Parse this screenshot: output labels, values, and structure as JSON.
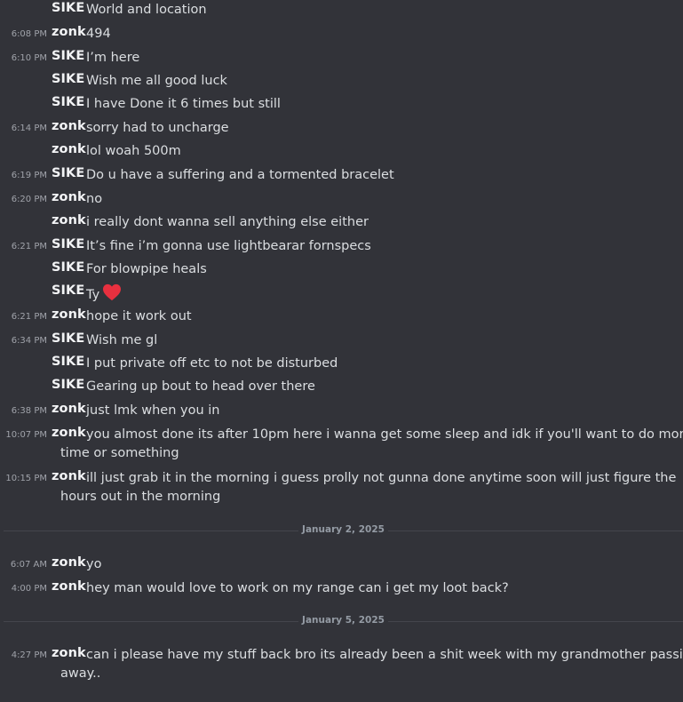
{
  "messages": [
    {
      "time": "",
      "author": "SIKE",
      "text": "World and location"
    },
    {
      "time": "6:08 PM",
      "author": "zonk",
      "text": "494"
    },
    {
      "time": "6:10 PM",
      "author": "SIKE",
      "text": "I’m here"
    },
    {
      "time": "",
      "author": "SIKE",
      "text": "Wish me all good luck"
    },
    {
      "time": "",
      "author": "SIKE",
      "text": "I have Done it 6 times but still"
    },
    {
      "time": "6:14 PM",
      "author": "zonk",
      "text": "sorry had to uncharge"
    },
    {
      "time": "",
      "author": "zonk",
      "text": "lol woah 500m"
    },
    {
      "time": "6:19 PM",
      "author": "SIKE",
      "text": "Do u have a suffering and a tormented bracelet"
    },
    {
      "time": "6:20 PM",
      "author": "zonk",
      "text": "no"
    },
    {
      "time": "",
      "author": "zonk",
      "text": "i really dont wanna sell anything else either"
    },
    {
      "time": "6:21 PM",
      "author": "SIKE",
      "text": "It’s fine i’m gonna use lightbearar fornspecs"
    },
    {
      "time": "",
      "author": "SIKE",
      "text": "For blowpipe heals"
    },
    {
      "time": "",
      "author": "SIKE",
      "text": "Ty",
      "emoji": "heart-icon"
    },
    {
      "time": "6:21 PM",
      "author": "zonk",
      "text": "hope it work out"
    },
    {
      "time": "6:34 PM",
      "author": "SIKE",
      "text": "Wish me gl"
    },
    {
      "time": "",
      "author": "SIKE",
      "text": "I put private off etc to not be disturbed"
    },
    {
      "time": "",
      "author": "SIKE",
      "text": "Gearing up bout to head over there"
    },
    {
      "time": "6:38 PM",
      "author": "zonk",
      "text": "just lmk when you in"
    },
    {
      "time": "10:07 PM",
      "author": "zonk",
      "text": "you almost done its after 10pm here i wanna get some sleep and idk if you'll want to do more",
      "text2": "time or something"
    },
    {
      "time": "10:15 PM",
      "author": "zonk",
      "text": "ill just grab it in the morning i guess prolly not gunna done anytime soon will just figure the",
      "text2": "hours out in the morning"
    },
    {
      "time": "6:07 AM",
      "author": "zonk",
      "text": "yo"
    },
    {
      "time": "4:00 PM",
      "author": "zonk",
      "text": "hey man would love to work on my range can i get my loot back?"
    },
    {
      "time": "4:27 PM",
      "author": "zonk",
      "text": "can i please have my stuff back bro its already been a shit week with my grandmother passing",
      "text2": "away.."
    }
  ],
  "dividers": [
    {
      "date": "January 2, 2025"
    },
    {
      "date": "January 5, 2025"
    }
  ],
  "colors": {
    "background": "#323339",
    "heart": "#e8303f"
  }
}
